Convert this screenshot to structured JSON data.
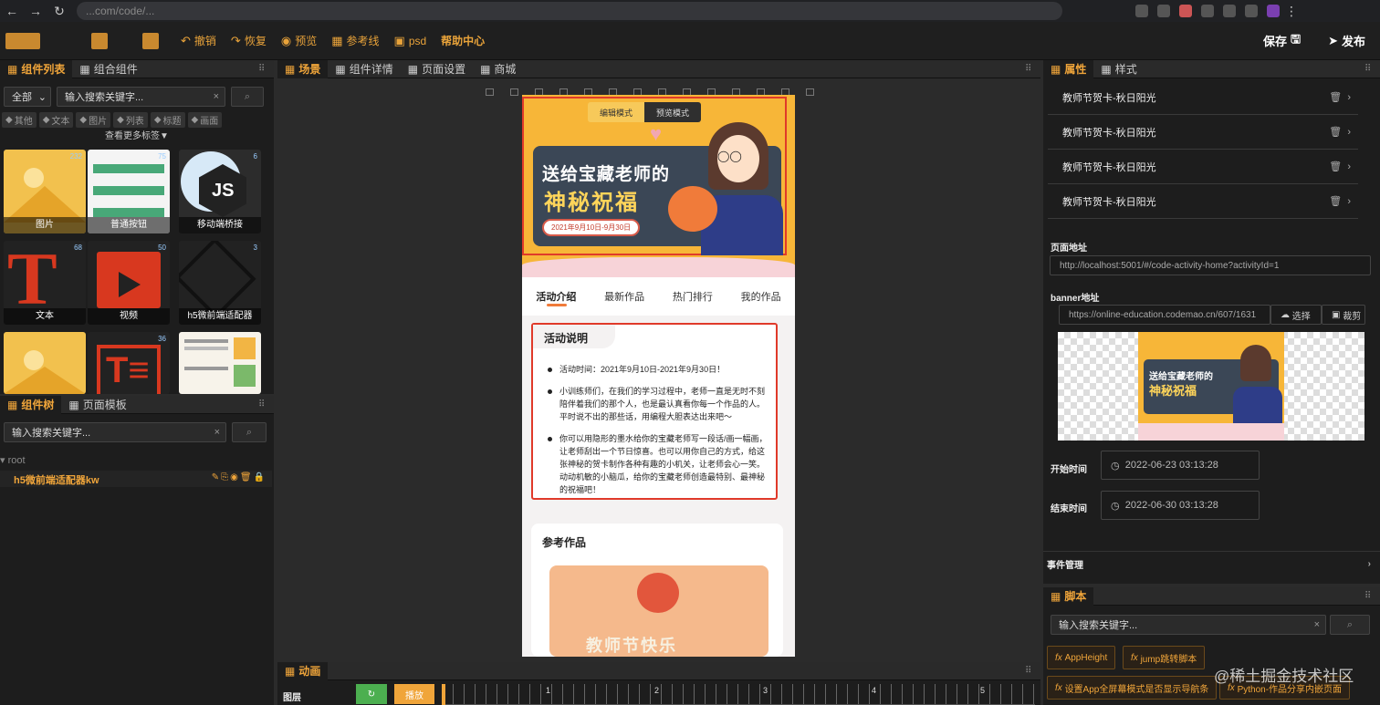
{
  "browser": {
    "url_text": "...com/code/..."
  },
  "topbar": {
    "undo": "撤销",
    "redo": "恢复",
    "preview": "预览",
    "guides": "参考线",
    "psd": "psd",
    "help": "帮助中心",
    "save": "保存",
    "publish": "发布"
  },
  "left_top": {
    "tabs": [
      "组件列表",
      "组合组件"
    ],
    "filter_select": "全部",
    "search_placeholder": "输入搜索关键字...",
    "tags": [
      "其他",
      "文本",
      "图片",
      "列表",
      "标题",
      "画面"
    ],
    "more_tags": "查看更多标签▼",
    "cards": [
      {
        "label": "图片",
        "count": "232"
      },
      {
        "label": "普通按钮",
        "count": "75"
      },
      {
        "label": "移动端桥接",
        "count": "6"
      },
      {
        "label": "文本",
        "count": "68"
      },
      {
        "label": "视频",
        "count": "50"
      },
      {
        "label": "h5微前端适配器",
        "count": "3"
      },
      {
        "label": "",
        "count": ""
      },
      {
        "label": "",
        "count": "36"
      },
      {
        "label": "",
        "count": ""
      }
    ]
  },
  "left_bottom": {
    "tabs": [
      "组件树",
      "页面模板"
    ],
    "search_placeholder": "输入搜索关键字...",
    "root": "root",
    "node": "h5微前端适配器kw"
  },
  "center": {
    "tabs": [
      "场景",
      "组件详情",
      "页面设置",
      "商城"
    ],
    "phone": {
      "mode_edit": "编辑模式",
      "mode_preview": "预览模式",
      "banner_title1": "送给宝藏老师的",
      "banner_title2": "神秘祝福",
      "banner_date": "2021年9月10日-9月30日",
      "tabs": [
        "活动介绍",
        "最新作品",
        "热门排行",
        "我的作品"
      ],
      "section_title": "活动说明",
      "bullets": [
        "活动时间：2021年9月10日-2021年9月30日！",
        "小训练师们，在我们的学习过程中，老师一直是无时不刻陪伴着我们的那个人，也是最认真看你每一个作品的人。平时说不出的那些话，用编程大胆表达出来吧～",
        "你可以用隐形的墨水给你的宝藏老师写一段话/画一幅画，让老师刮出一个节日惊喜。也可以用你自己的方式，给这张神秘的贺卡制作各种有趣的小机关，让老师会心一笑。动动机敏的小脑瓜，给你的宝藏老师创造最特别、最神秘的祝福吧！"
      ],
      "ref_title": "参考作品",
      "ref_caption": "教师节快乐"
    }
  },
  "anim": {
    "title": "动画",
    "layer": "图层",
    "play": "播放",
    "ticks": [
      "1",
      "2",
      "3",
      "4",
      "5"
    ]
  },
  "right": {
    "tabs": [
      "属性",
      "样式"
    ],
    "items": [
      "教师节贺卡-秋日阳光",
      "教师节贺卡-秋日阳光",
      "教师节贺卡-秋日阳光",
      "教师节贺卡-秋日阳光"
    ],
    "page_url_label": "页面地址",
    "page_url": "http://localhost:5001/#/code-activity-home?activityId=1",
    "banner_label": "banner地址",
    "banner_url": "https://online-education.codemao.cn/607/1631",
    "choose": "选择",
    "crop": "裁剪",
    "preview_title1": "送给宝藏老师的",
    "preview_title2": "神秘祝福",
    "start_label": "开始时间",
    "start_value": "2022-06-23 03:13:28",
    "end_label": "结束时间",
    "end_value": "2022-06-30 03:13:28",
    "events": "事件管理",
    "script_title": "脚本",
    "script_search": "输入搜索关键字...",
    "scripts": [
      "AppHeight",
      "jump跳转脚本",
      "设置App全屏幕模式是否显示导航条",
      "Python-作品分享内嵌页面"
    ],
    "watermark": "@稀土掘金技术社区"
  },
  "colors": {
    "accent": "#f0a53a",
    "panel": "#1d1d1d",
    "stage": "#2b2b2b",
    "highlight": "#e03a2a"
  }
}
